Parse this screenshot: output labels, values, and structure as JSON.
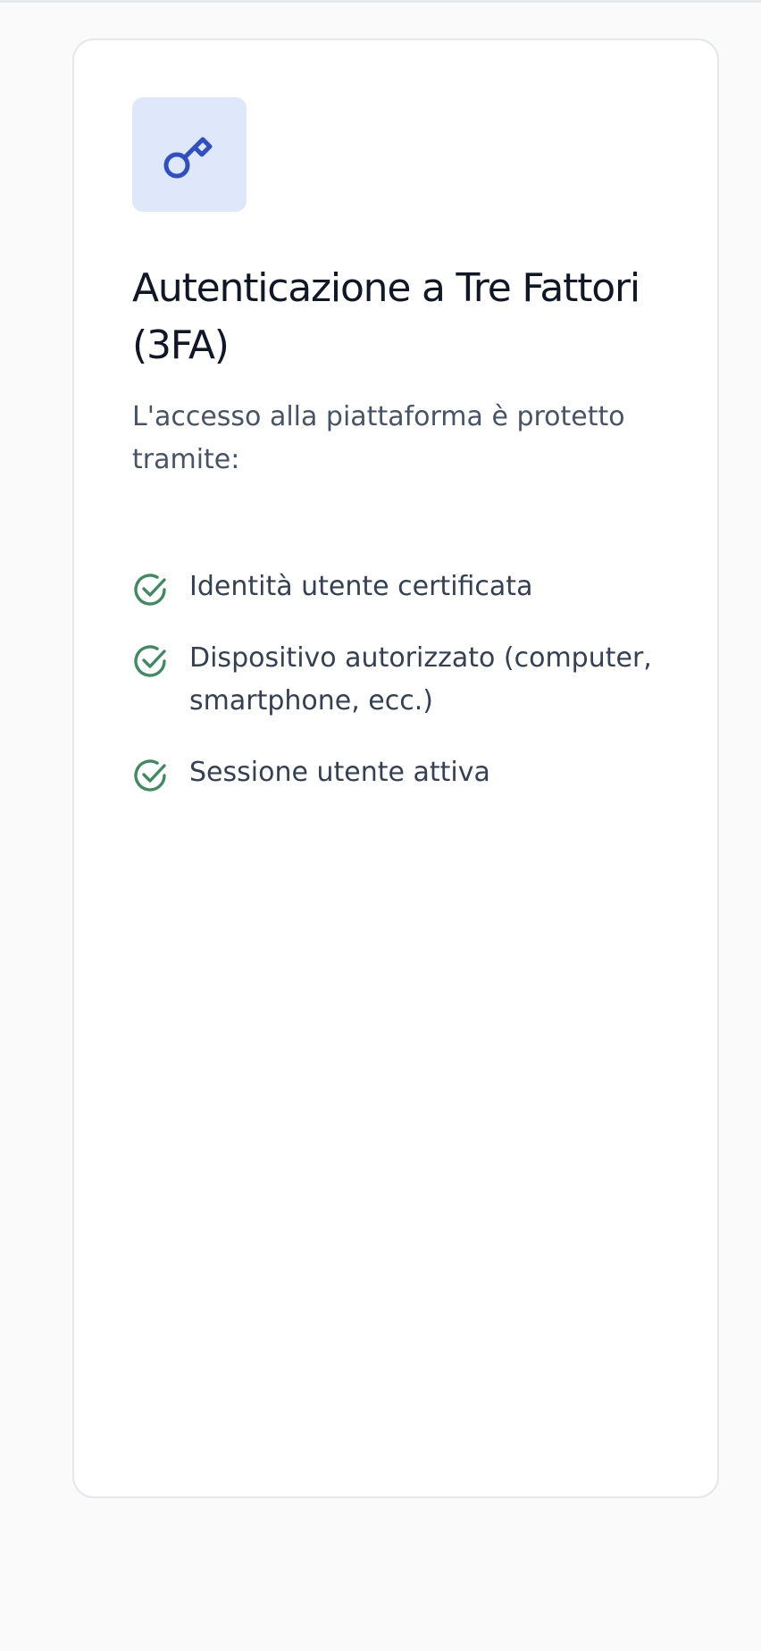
{
  "colors": {
    "page_background": "#fafafa",
    "card_background": "#ffffff",
    "icon_tile": "#dfe8fb",
    "key_icon": "#2f4fc2",
    "check_icon": "#3f8a60",
    "title_text": "#101828",
    "body_text": "#344054"
  },
  "card": {
    "icon": "key-icon",
    "title": "Autenticazione a Tre Fattori (3FA)",
    "description": "L'accesso alla piattaforma è protetto tramite:",
    "factors": [
      {
        "icon": "check-circle-icon",
        "label": "Identità utente certificata"
      },
      {
        "icon": "check-circle-icon",
        "label": "Dispositivo autorizzato (computer, smartphone, ecc.)"
      },
      {
        "icon": "check-circle-icon",
        "label": "Sessione utente attiva"
      }
    ]
  }
}
